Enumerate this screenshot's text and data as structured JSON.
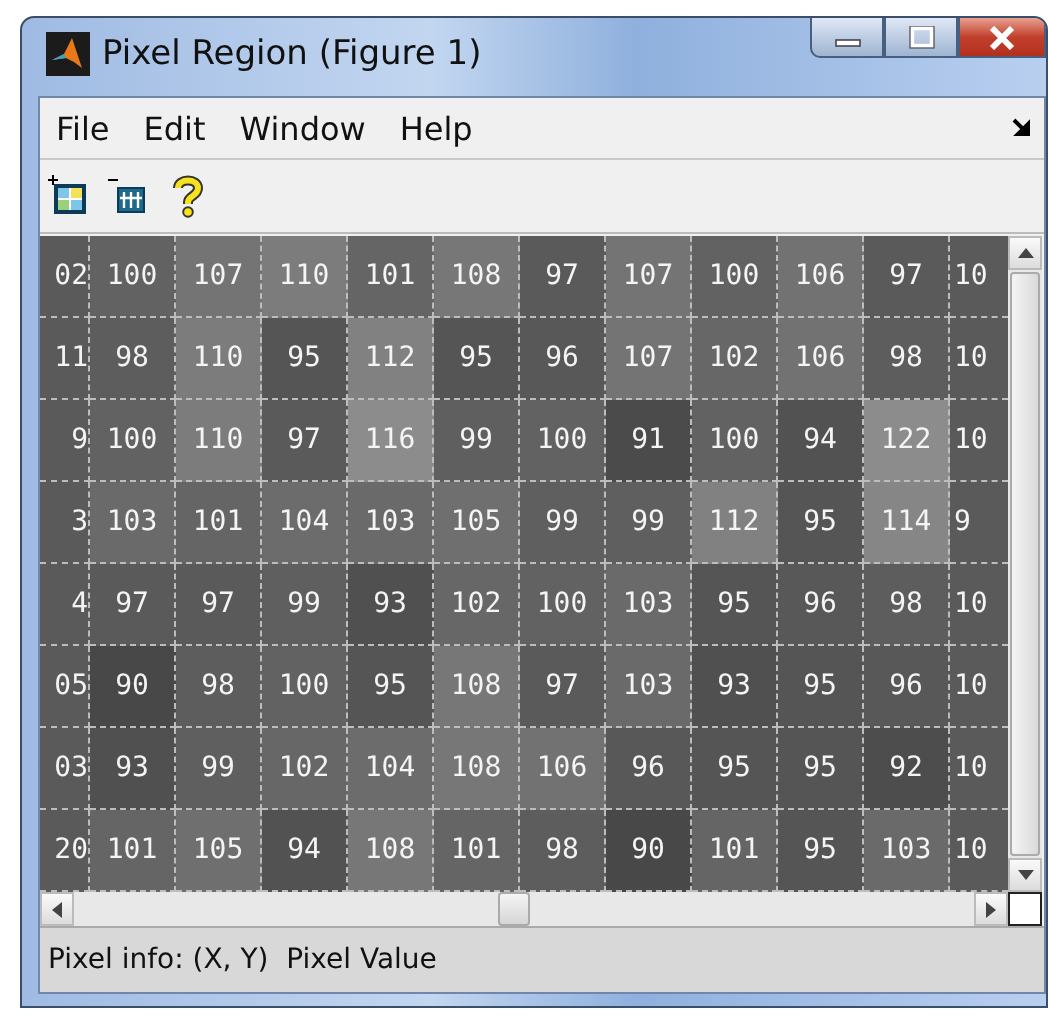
{
  "window": {
    "title": "Pixel Region (Figure 1)"
  },
  "menu": [
    "File",
    "Edit",
    "Window",
    "Help"
  ],
  "grid": {
    "rows": [
      [
        "02",
        "100",
        "107",
        "110",
        "101",
        "108",
        "97",
        "107",
        "100",
        "106",
        "97",
        "10"
      ],
      [
        "11",
        "98",
        "110",
        "95",
        "112",
        "95",
        "96",
        "107",
        "102",
        "106",
        "98",
        "10"
      ],
      [
        "9",
        "100",
        "110",
        "97",
        "116",
        "99",
        "100",
        "91",
        "100",
        "94",
        "122",
        "10"
      ],
      [
        "3",
        "103",
        "101",
        "104",
        "103",
        "105",
        "99",
        "99",
        "112",
        "95",
        "114",
        "9"
      ],
      [
        "4",
        "97",
        "97",
        "99",
        "93",
        "102",
        "100",
        "103",
        "95",
        "96",
        "98",
        "10"
      ],
      [
        "05",
        "90",
        "98",
        "100",
        "95",
        "108",
        "97",
        "103",
        "93",
        "95",
        "96",
        "10"
      ],
      [
        "03",
        "93",
        "99",
        "102",
        "104",
        "108",
        "106",
        "96",
        "95",
        "95",
        "92",
        "10"
      ],
      [
        "20",
        "101",
        "105",
        "94",
        "108",
        "101",
        "98",
        "90",
        "101",
        "95",
        "103",
        "10"
      ]
    ]
  },
  "status_bar": "Pixel info: (X, Y)  Pixel Value"
}
